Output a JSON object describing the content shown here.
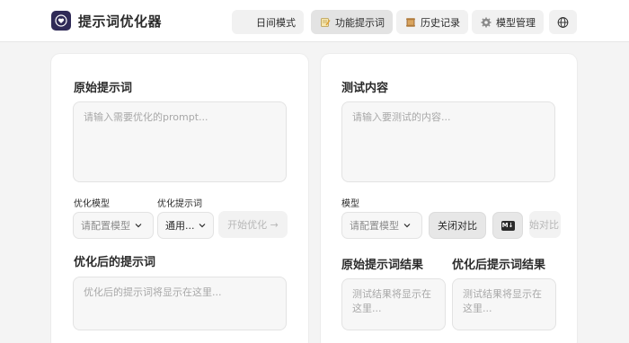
{
  "app": {
    "title": "提示词优化器",
    "logo_icon": "heart-shield-icon"
  },
  "nav": {
    "items": [
      {
        "label": "日间模式",
        "icon": "moon-icon"
      },
      {
        "label": "功能提示词",
        "icon": "memo-icon",
        "active": true
      },
      {
        "label": "历史记录",
        "icon": "scroll-icon"
      },
      {
        "label": "模型管理",
        "icon": "gear-icon"
      },
      {
        "label": "",
        "icon": "globe-icon"
      }
    ]
  },
  "left": {
    "original_title": "原始提示词",
    "original_placeholder": "请输入需要优化的prompt...",
    "model_label": "优化模型",
    "model_select": "请配置模型",
    "template_label": "优化提示词",
    "template_select": "通用...",
    "optimize_button": "开始优化 →",
    "optimized_title": "优化后的提示词",
    "optimized_placeholder": "优化后的提示词将显示在这里..."
  },
  "right": {
    "test_title": "测试内容",
    "test_placeholder": "请输入要测试的内容...",
    "model_label": "模型",
    "model_select": "请配置模型",
    "compare_button": "关闭对比",
    "markdown_badge": "M↓",
    "start_compare_button": "始对比",
    "original_result_title": "原始提示词结果",
    "original_result_placeholder": "测试结果将显示在这里...",
    "optimized_result_title": "优化后提示词结果",
    "optimized_result_placeholder": "测试结果将显示在这里..."
  },
  "colors": {
    "background": "#f4f4f4",
    "card": "#ffffff",
    "logo": "#2f2a57",
    "active_nav": "#e3e3e3"
  }
}
